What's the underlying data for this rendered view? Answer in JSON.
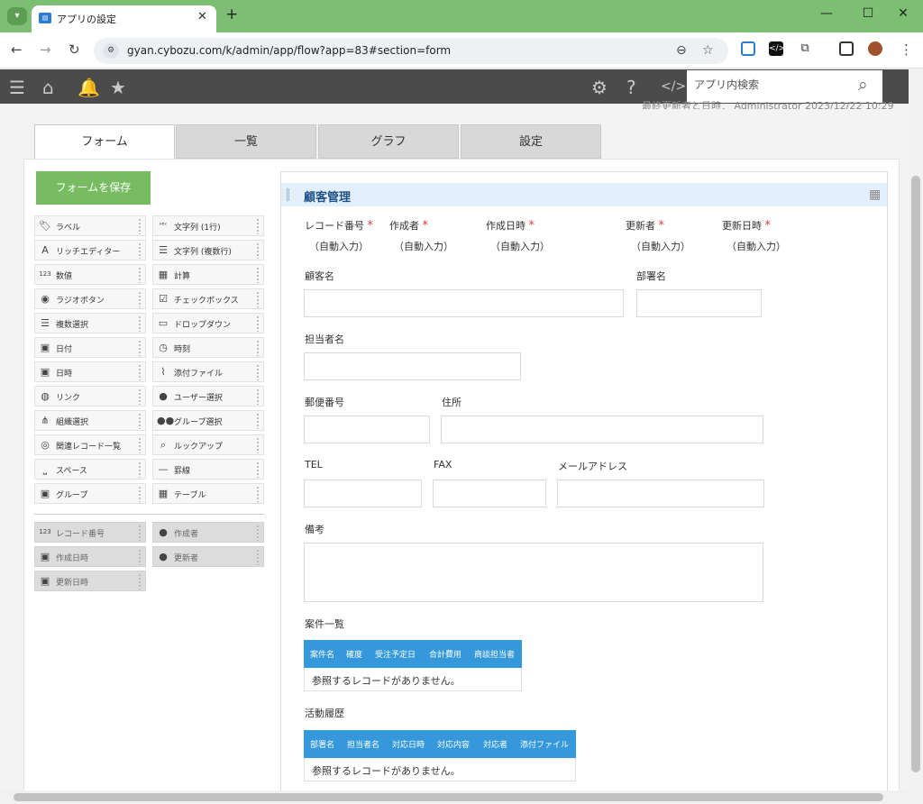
{
  "browser": {
    "tab_title": "アプリの設定",
    "url": "gyan.cybozu.com/k/admin/app/flow?app=83#section=form",
    "new_tab": "+",
    "close_tab": "✕"
  },
  "header": {
    "search_placeholder": "アプリ内検索",
    "updated_text": "最終更新者と日時： Administrator 2023/12/22 10:29"
  },
  "tabs": [
    {
      "label": "フォーム",
      "active": true
    },
    {
      "label": "一覧",
      "active": false
    },
    {
      "label": "グラフ",
      "active": false
    },
    {
      "label": "設定",
      "active": false
    }
  ],
  "save_button": "フォームを保存",
  "palette": {
    "fields": [
      {
        "label": "ラベル",
        "icon": "tag-icon"
      },
      {
        "label": "文字列 (1行)",
        "icon": "abc-icon"
      },
      {
        "label": "リッチエディター",
        "icon": "rich-text-icon"
      },
      {
        "label": "文字列 (複数行)",
        "icon": "multiline-icon"
      },
      {
        "label": "数値",
        "icon": "number-icon"
      },
      {
        "label": "計算",
        "icon": "calculator-icon"
      },
      {
        "label": "ラジオボタン",
        "icon": "radio-icon"
      },
      {
        "label": "チェックボックス",
        "icon": "checkbox-icon"
      },
      {
        "label": "複数選択",
        "icon": "multi-select-icon"
      },
      {
        "label": "ドロップダウン",
        "icon": "dropdown-icon"
      },
      {
        "label": "日付",
        "icon": "calendar-icon"
      },
      {
        "label": "時刻",
        "icon": "clock-icon"
      },
      {
        "label": "日時",
        "icon": "datetime-icon"
      },
      {
        "label": "添付ファイル",
        "icon": "paperclip-icon"
      },
      {
        "label": "リンク",
        "icon": "globe-icon"
      },
      {
        "label": "ユーザー選択",
        "icon": "user-icon"
      },
      {
        "label": "組織選択",
        "icon": "org-icon"
      },
      {
        "label": "グループ選択",
        "icon": "group-icon"
      },
      {
        "label": "関連レコード一覧",
        "icon": "related-records-icon"
      },
      {
        "label": "ルックアップ",
        "icon": "lookup-icon"
      },
      {
        "label": "スペース",
        "icon": "space-icon"
      },
      {
        "label": "罫線",
        "icon": "line-icon"
      },
      {
        "label": "グループ",
        "icon": "group-field-icon"
      },
      {
        "label": "テーブル",
        "icon": "table-icon"
      }
    ],
    "system_fields": [
      {
        "label": "レコード番号",
        "icon": "number-icon"
      },
      {
        "label": "作成者",
        "icon": "user-icon"
      },
      {
        "label": "作成日時",
        "icon": "calendar-icon"
      },
      {
        "label": "更新者",
        "icon": "user-icon"
      },
      {
        "label": "更新日時",
        "icon": "calendar-icon"
      }
    ]
  },
  "form": {
    "group_title": "顧客管理",
    "auto_fields": [
      {
        "label": "レコード番号",
        "value": "（自動入力）"
      },
      {
        "label": "作成者",
        "value": "（自動入力）"
      },
      {
        "label": "作成日時",
        "value": "（自動入力）"
      },
      {
        "label": "更新者",
        "value": "（自動入力）"
      },
      {
        "label": "更新日時",
        "value": "（自動入力）"
      }
    ],
    "required_mark": "*",
    "customer_name": "顧客名",
    "department": "部署名",
    "contact_person": "担当者名",
    "postal_code": "郵便番号",
    "address": "住所",
    "tel": "TEL",
    "fax": "FAX",
    "email": "メールアドレス",
    "notes": "備考",
    "deals_table": {
      "title": "案件一覧",
      "columns": [
        "案件名",
        "確度",
        "受注予定日",
        "合計費用",
        "商談担当者"
      ],
      "empty": "参照するレコードがありません。"
    },
    "activity_table": {
      "title": "活動履歴",
      "columns": [
        "部署名",
        "担当者名",
        "対応日時",
        "対応内容",
        "対応者",
        "添付ファイル"
      ],
      "empty": "参照するレコードがありません。"
    }
  }
}
